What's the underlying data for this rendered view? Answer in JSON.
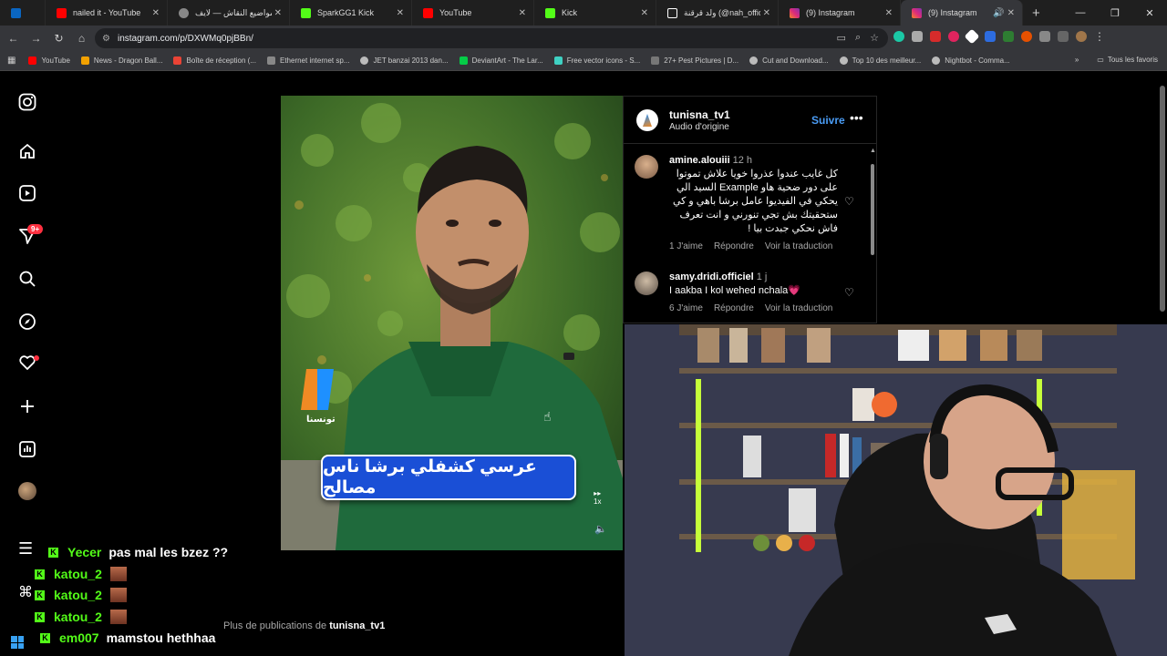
{
  "browser": {
    "tabs": [
      {
        "title": "",
        "icon": "linkedin-icon",
        "color": "#0a66c2"
      },
      {
        "title": "nailed it - YouTube",
        "icon": "youtube-icon",
        "color": "#ff0000"
      },
      {
        "title": "مواضيع النقاش — لايف",
        "icon": "globe-icon",
        "color": "#bbbbbb"
      },
      {
        "title": "SparkGG1 Kick",
        "icon": "kick-icon",
        "color": "#53fc18"
      },
      {
        "title": "YouTube",
        "icon": "youtube-icon",
        "color": "#ff0000"
      },
      {
        "title": "Kick",
        "icon": "kick-icon",
        "color": "#53fc18"
      },
      {
        "title": "ولد قرقنة (@nah_officel",
        "icon": "tiktok-icon",
        "color": "#ffffff"
      },
      {
        "title": "(9) Instagram",
        "icon": "instagram-icon",
        "color": "#e1306c"
      },
      {
        "title": "(9) Instagram",
        "icon": "instagram-icon",
        "color": "#e1306c",
        "active": true
      }
    ],
    "url": "instagram.com/p/DXWMq0pjBBn/",
    "bookmarks": [
      {
        "label": "YouTube",
        "color": "#ff0000"
      },
      {
        "label": "News - Dragon Ball...",
        "color": "#f2a100"
      },
      {
        "label": "Boîte de réception (...",
        "color": "#ea4335"
      },
      {
        "label": "Ethernet internet sp...",
        "color": "#888888"
      },
      {
        "label": "JET banzai 2013 dan...",
        "color": "#bbbbbb"
      },
      {
        "label": "DeviantArt - The Lar...",
        "color": "#05cc47"
      },
      {
        "label": "Free vector icons - S...",
        "color": "#3fd1c3"
      },
      {
        "label": "27+ Pest Pictures | D...",
        "color": "#777777"
      },
      {
        "label": "Cut and Download...",
        "color": "#bbbbbb"
      },
      {
        "label": "Top 10 des meilleur...",
        "color": "#bbbbbb"
      },
      {
        "label": "Nightbot - Comma...",
        "color": "#bbbbbb"
      }
    ],
    "all_bookmarks": "Tous les favoris"
  },
  "instagram": {
    "notification_badge": "9+",
    "post": {
      "channel_logo_text": "تونسنا",
      "caption": "عرسي كشفلي برشا ناس مصالح",
      "speed": "1x"
    },
    "panel": {
      "username": "tunisna_tv1",
      "audio": "Audio d'origine",
      "follow": "Suivre",
      "comments": [
        {
          "user": "amine.alouiii",
          "time": "12 h",
          "text": "كل غايب عندوا عذروا خويا علاش تموتوا على دور ضحية هاو Example السيد الي يحكي في الفيديوا عامل برشا باهي و كي ستحقيتك بش تجي تنورني و انت تعرف فاش نحكي جبدت بيا !",
          "likes": "1 J'aime",
          "reply": "Répondre",
          "translate": "Voir la traduction"
        },
        {
          "user": "samy.dridi.officiel",
          "time": "1 j",
          "text": "I aakba I kol wehed nchala💗",
          "likes": "6 J'aime",
          "reply": "Répondre",
          "translate": "Voir la traduction"
        }
      ]
    },
    "more_posts_prefix": "Plus de publications de",
    "more_posts_user": "tunisna_tv1"
  },
  "chat": [
    {
      "name": "Yecer",
      "message": "pas mal les bzez ??"
    },
    {
      "name": "katou_2",
      "message": ""
    },
    {
      "name": "katou_2",
      "message": ""
    },
    {
      "name": "katou_2",
      "message": ""
    },
    {
      "name": "em007",
      "message": "mamstou hethhaa"
    }
  ]
}
